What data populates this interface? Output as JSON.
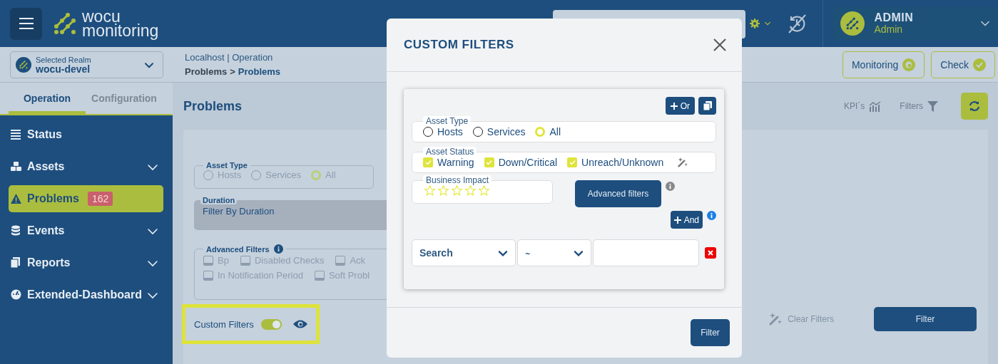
{
  "header": {
    "brand": [
      "wocu",
      "monitoring"
    ],
    "user": {
      "name": "ADMIN",
      "role": "Admin"
    }
  },
  "realm": {
    "label": "Selected Realm",
    "value": "wocu-devel"
  },
  "breadcrumb": {
    "line_1": "Localhost | Operation",
    "line_2": [
      "Problems",
      ">",
      "Problems"
    ]
  },
  "top_buttons": [
    {
      "label": "Monitoring",
      "kind": "eye"
    },
    {
      "label": "Check",
      "kind": "check"
    }
  ],
  "sidebar": {
    "tabs": [
      {
        "label": "Operation",
        "selected": true
      },
      {
        "label": "Configuration",
        "selected": false
      }
    ],
    "items": [
      {
        "label": "Status",
        "selected": false,
        "submenu": false
      },
      {
        "label": "Assets",
        "selected": false,
        "submenu": true
      },
      {
        "label": "Problems",
        "selected": true,
        "submenu": false,
        "badge": "162"
      },
      {
        "label": "Events",
        "selected": false,
        "submenu": true
      },
      {
        "label": "Reports",
        "selected": false,
        "submenu": true
      },
      {
        "label": "Extended-Dashboard",
        "selected": false,
        "submenu": true
      }
    ]
  },
  "page": {
    "title": "Problems",
    "tools": [
      {
        "label": "KPI´s",
        "kind": "chart"
      },
      {
        "label": "Filters",
        "kind": "funnel"
      }
    ]
  },
  "filters_panel": {
    "asset_type": {
      "legend": "Asset Type",
      "options": [
        {
          "label": "Hosts",
          "selected": false
        },
        {
          "label": "Services",
          "selected": false
        },
        {
          "label": "All",
          "selected": true
        }
      ]
    },
    "duration": {
      "label": "Duration",
      "value": "Filter By Duration"
    },
    "advanced_filters": {
      "legend": "Advanced Filters",
      "options": [
        {
          "label": "Bp",
          "checked": false
        },
        {
          "label": "Disabled Checks",
          "checked": false
        },
        {
          "label": "Ack",
          "checked": false
        },
        {
          "label": "In Notification Period",
          "checked": false
        },
        {
          "label": "Soft Probl",
          "checked": false
        }
      ]
    },
    "custom_filters": {
      "label": "Custom Filters",
      "on": true
    },
    "clear_filters": "Clear Filters",
    "filter_button": "Filter"
  },
  "modal": {
    "title": "CUSTOM FILTERS",
    "or_button": "Or",
    "and_button": "And",
    "asset_type": {
      "legend": "Asset Type",
      "options": [
        {
          "label": "Hosts",
          "selected": false
        },
        {
          "label": "Services",
          "selected": false
        },
        {
          "label": "All",
          "selected": true
        }
      ]
    },
    "asset_status": {
      "legend": "Asset Status",
      "options": [
        {
          "label": "Warning",
          "checked": true
        },
        {
          "label": "Down/Critical",
          "checked": true
        },
        {
          "label": "Unreach/Unknown",
          "checked": true
        }
      ]
    },
    "business_impact": {
      "legend": "Business Impact",
      "stars": 0
    },
    "advanced_button": "Advanced filters",
    "condition": {
      "field": "Search",
      "operator": "~"
    },
    "filter_button": "Filter"
  }
}
